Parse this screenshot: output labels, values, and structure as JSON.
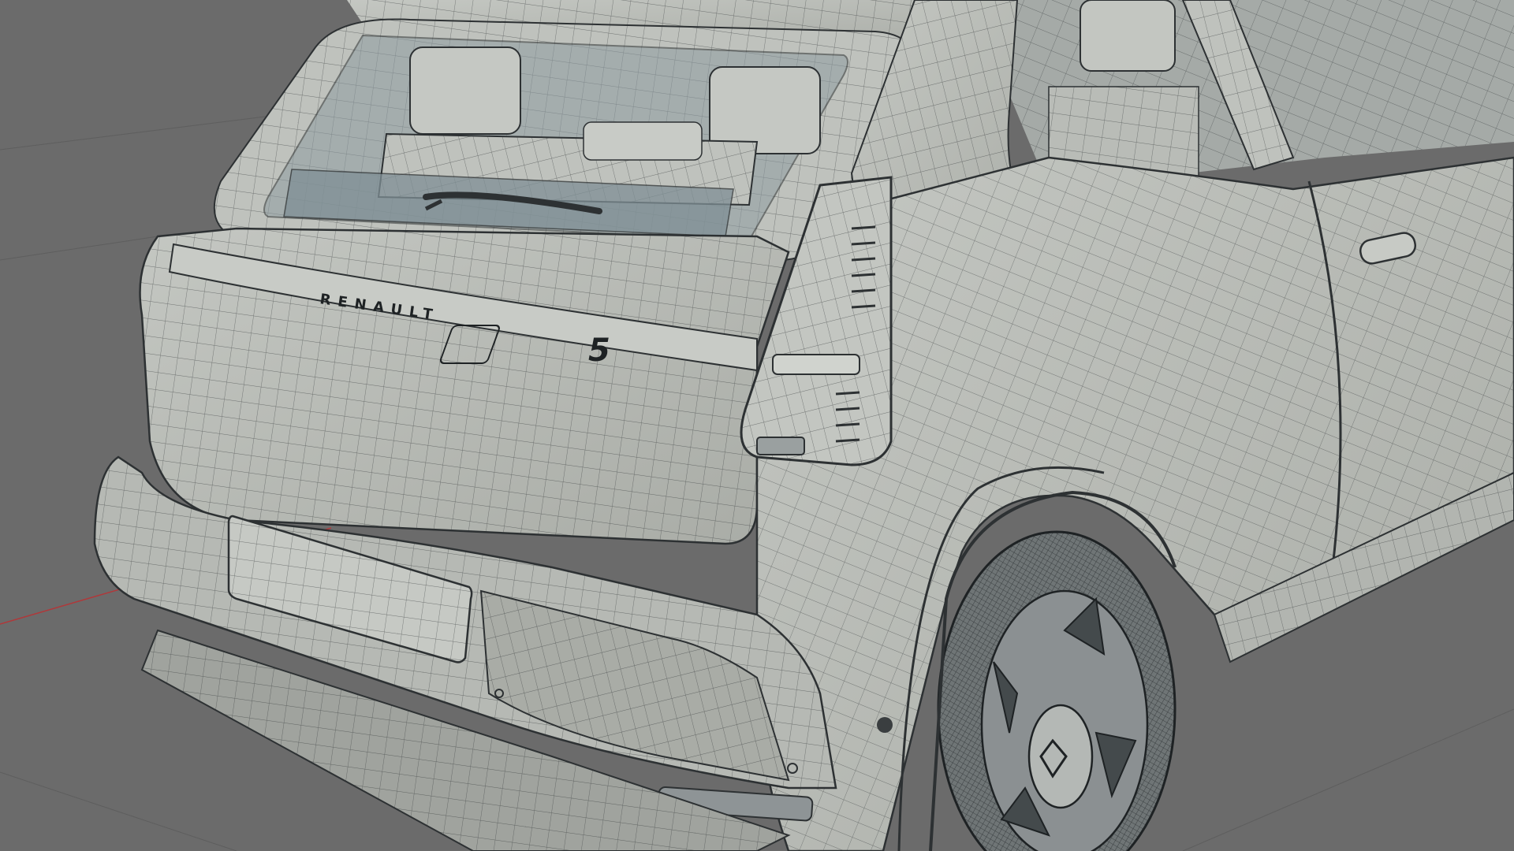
{
  "viewport": {
    "background": "#6b6b6b",
    "grid_color": "#5e5e5e",
    "x_axis_color": "#b0383a",
    "shading": "wireframe-on-solid"
  },
  "model": {
    "badge_text": "RENAULT",
    "emblem_text": "5",
    "body_color": "#b8bbb6",
    "wire_color": "#2d3133",
    "glass_color": "#8e9ca1"
  }
}
